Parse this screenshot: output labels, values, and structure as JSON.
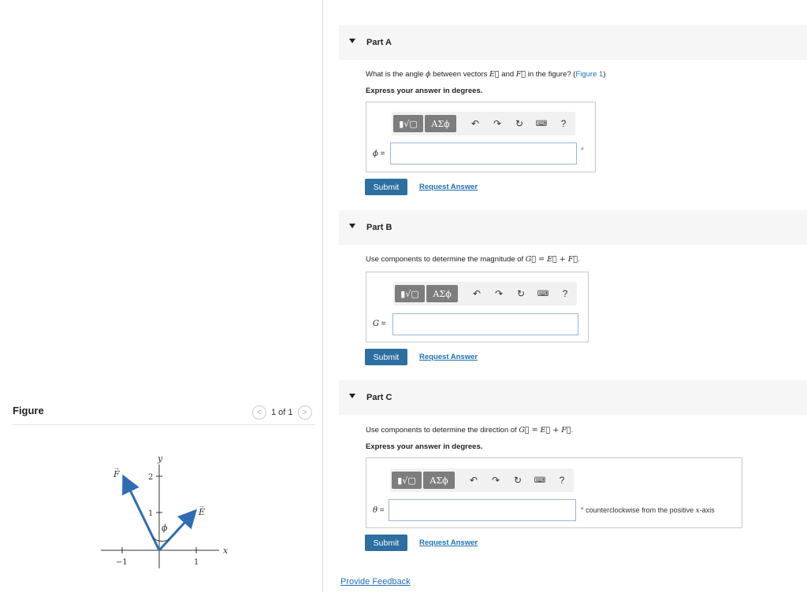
{
  "figure_panel": {
    "title": "Figure",
    "pager_text": "1 of 1",
    "prev_glyph": "<",
    "next_glyph": ">",
    "diagram": {
      "x_axis_label": "x",
      "y_axis_label": "y",
      "x_ticks": [
        "−1",
        "1"
      ],
      "y_ticks": [
        "1",
        "2"
      ],
      "vector_E_label": "E",
      "vector_F_label": "F",
      "angle_label": "ϕ",
      "vector_color": "#2e6db4"
    }
  },
  "toolbar": {
    "template_btn": "▮√▢",
    "greek_btn": "ΑΣϕ",
    "undo_icon": "undo-icon",
    "redo_icon": "redo-icon",
    "reset_icon": "reset-icon",
    "keyboard_icon": "keyboard-icon",
    "help_label": "?"
  },
  "parts": {
    "a": {
      "label": "Part A",
      "question_pre": "What is the angle ",
      "question_sym": "ϕ",
      "question_mid1": " between vectors ",
      "question_E": "E⃗",
      "question_and": " and ",
      "question_F": "F⃗",
      "question_post": " in the figure? (",
      "question_link": "Figure 1",
      "question_end": ")",
      "instruction": "Express your answer in degrees.",
      "variable": "ϕ",
      "eq": " =",
      "input_value": "",
      "unit": "°",
      "submit_label": "Submit",
      "request_label": "Request Answer"
    },
    "b": {
      "label": "Part B",
      "question_pre": "Use components to determine the magnitude of ",
      "question_expr": "G⃗ = E⃗ + F⃗",
      "question_end": ".",
      "variable": "G",
      "eq": " =",
      "input_value": "",
      "submit_label": "Submit",
      "request_label": "Request Answer"
    },
    "c": {
      "label": "Part C",
      "question_pre": "Use components to determine the direction of ",
      "question_expr": "G⃗ = E⃗ + F⃗",
      "question_end": ".",
      "instruction": "Express your answer in degrees.",
      "variable": "θ",
      "eq": " =",
      "input_value": "",
      "unit_pre": "° counterclockwise from the positive ",
      "unit_sym": "x",
      "unit_post": "-axis",
      "submit_label": "Submit",
      "request_label": "Request Answer"
    }
  },
  "footer": {
    "feedback_label": "Provide Feedback"
  },
  "colors": {
    "accent": "#2d6fa0",
    "link": "#1f6fb2",
    "header_bg": "#f6f6f6"
  }
}
